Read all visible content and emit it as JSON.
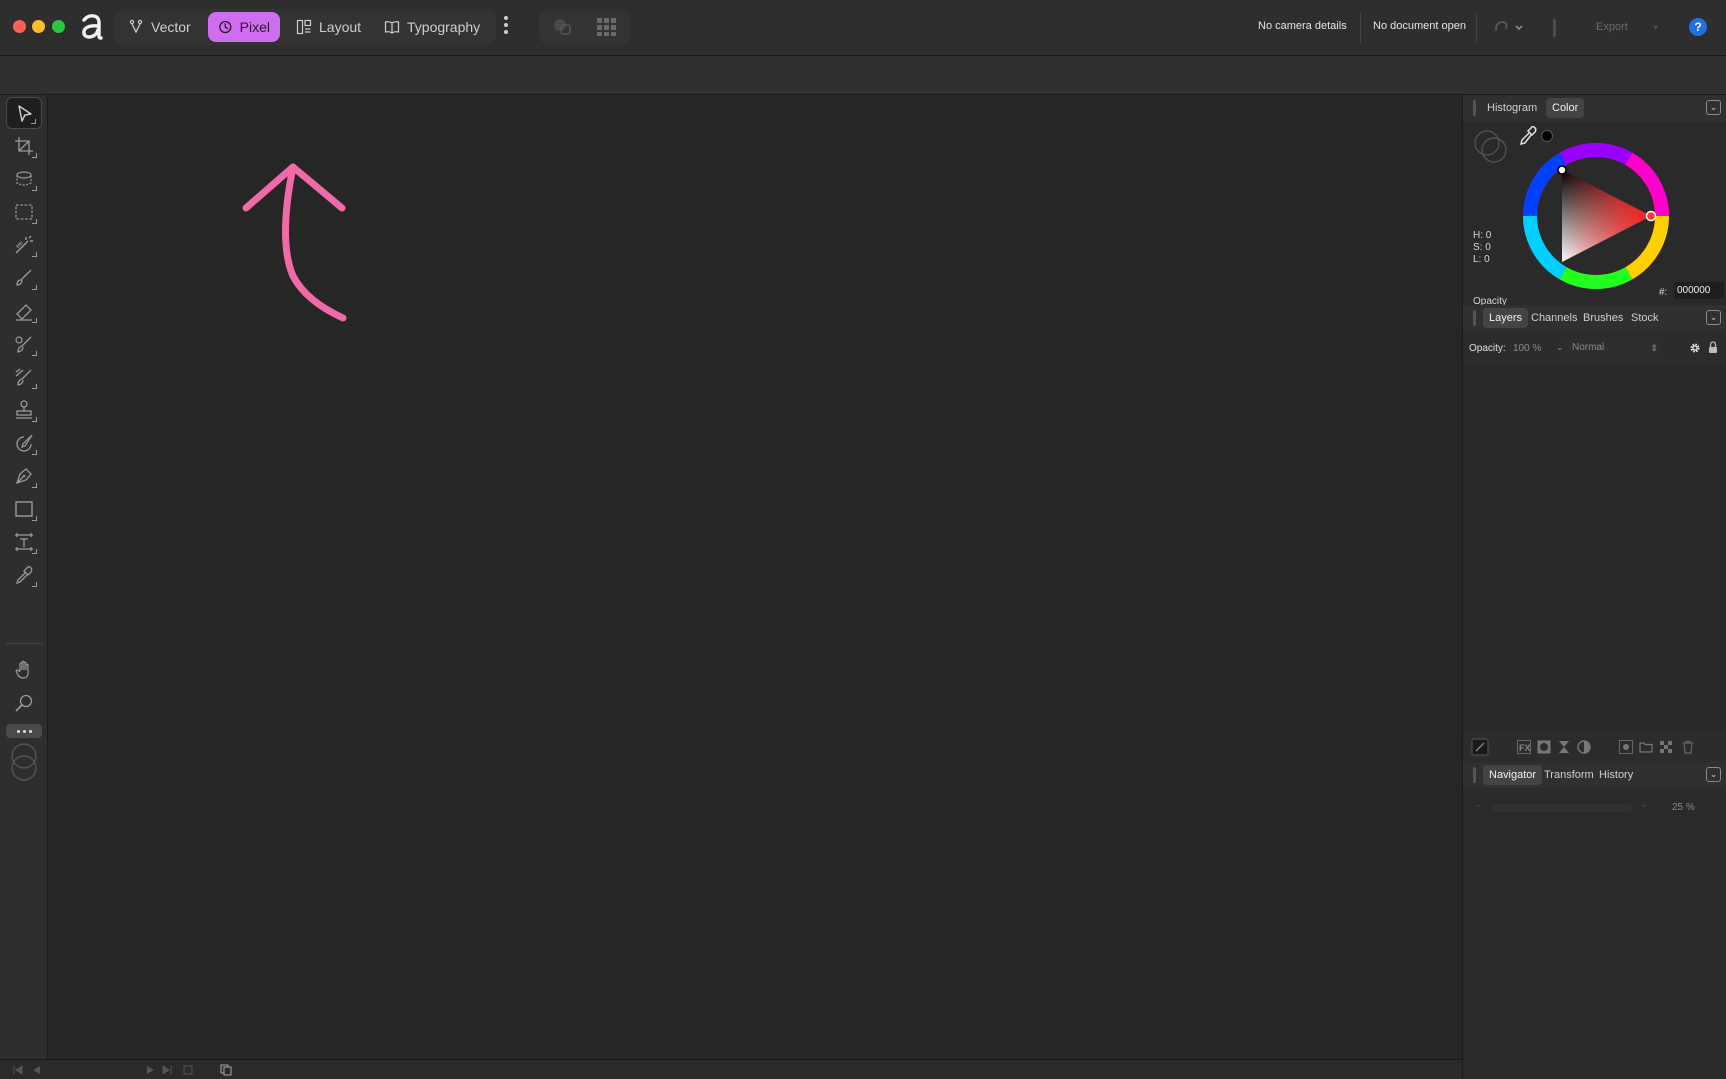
{
  "personas": {
    "vector": "Vector",
    "pixel": "Pixel",
    "layout": "Layout",
    "typography": "Typography"
  },
  "toolbar": {
    "camera_details": "No camera details",
    "document_status": "No document open",
    "export_label": "Export",
    "help": "?"
  },
  "color_panel": {
    "tabs": [
      "Histogram",
      "Color"
    ],
    "h": "H: 0",
    "s": "S: 0",
    "l": "L: 0",
    "hex_label": "#:",
    "hex_value": "000000",
    "opacity_label": "Opacity"
  },
  "layers_panel": {
    "tabs": [
      "Layers",
      "Channels",
      "Brushes",
      "Stock"
    ],
    "opacity_label": "Opacity:",
    "opacity_value": "100 %",
    "blend_mode": "Normal"
  },
  "navigator_panel": {
    "tabs": [
      "Navigator",
      "Transform",
      "History"
    ],
    "zoom": "25 %"
  },
  "colors": {
    "accent": "#cf6ef0",
    "annotation": "#f06aa8",
    "help_blue": "#1f6fe5"
  }
}
